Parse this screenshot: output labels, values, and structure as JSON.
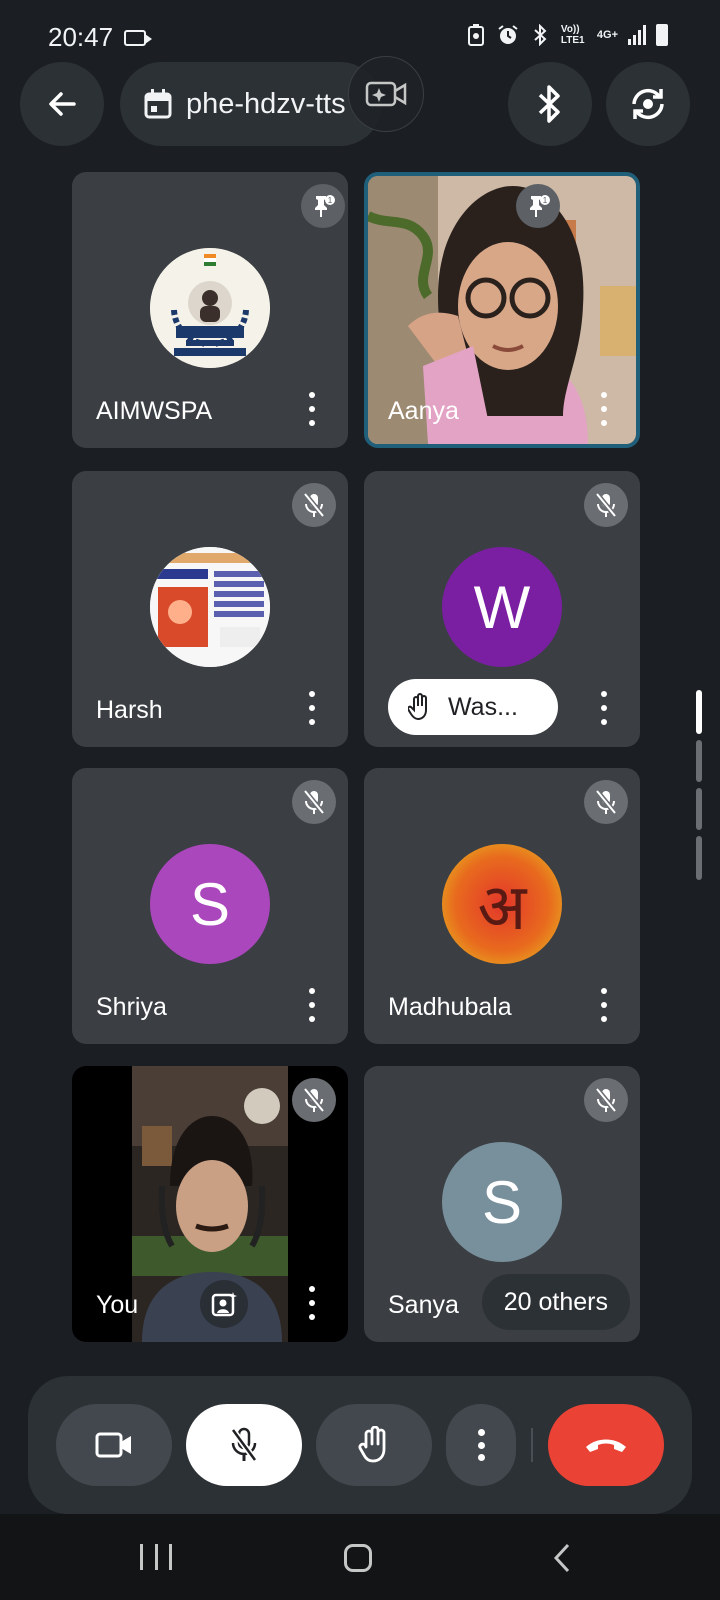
{
  "status_bar": {
    "time": "20:47",
    "network": "Vo)) LTE1",
    "network_type": "4G+"
  },
  "header": {
    "meeting_code": "phe-hdzv-tts",
    "icons": [
      "back-arrow-icon",
      "calendar-icon",
      "video-effects-icon",
      "bluetooth-icon",
      "switch-camera-icon"
    ]
  },
  "participants": [
    {
      "name": "AIMWSPA",
      "avatar_type": "logo",
      "pinned": true,
      "muted": false
    },
    {
      "name": "Aanya",
      "avatar_type": "video",
      "pinned": true,
      "muted": false,
      "speaking": true
    },
    {
      "name": "Harsh",
      "avatar_type": "image",
      "muted": true
    },
    {
      "name": "Was...",
      "avatar_type": "initial",
      "initial": "W",
      "color": "#7b1fa2",
      "muted": true,
      "hand_raised": true
    },
    {
      "name": "Shriya",
      "avatar_type": "initial",
      "initial": "S",
      "color": "#ab47bc",
      "muted": true
    },
    {
      "name": "Madhubala",
      "avatar_type": "image",
      "glyph": "अ",
      "muted": true
    },
    {
      "name": "You",
      "avatar_type": "video",
      "muted": true
    },
    {
      "name": "Sanya",
      "avatar_type": "initial",
      "initial": "S",
      "color": "#78909c",
      "muted": true
    }
  ],
  "others_badge": "20 others",
  "controls": {
    "icons": [
      "camera-icon",
      "mic-off-icon",
      "raise-hand-icon",
      "more-options-icon",
      "end-call-icon"
    ],
    "end_call_color": "#ea4335"
  },
  "colors": {
    "background": "#1b1f24",
    "tile": "#3b3f44",
    "active_border": "#1f5f7a"
  }
}
